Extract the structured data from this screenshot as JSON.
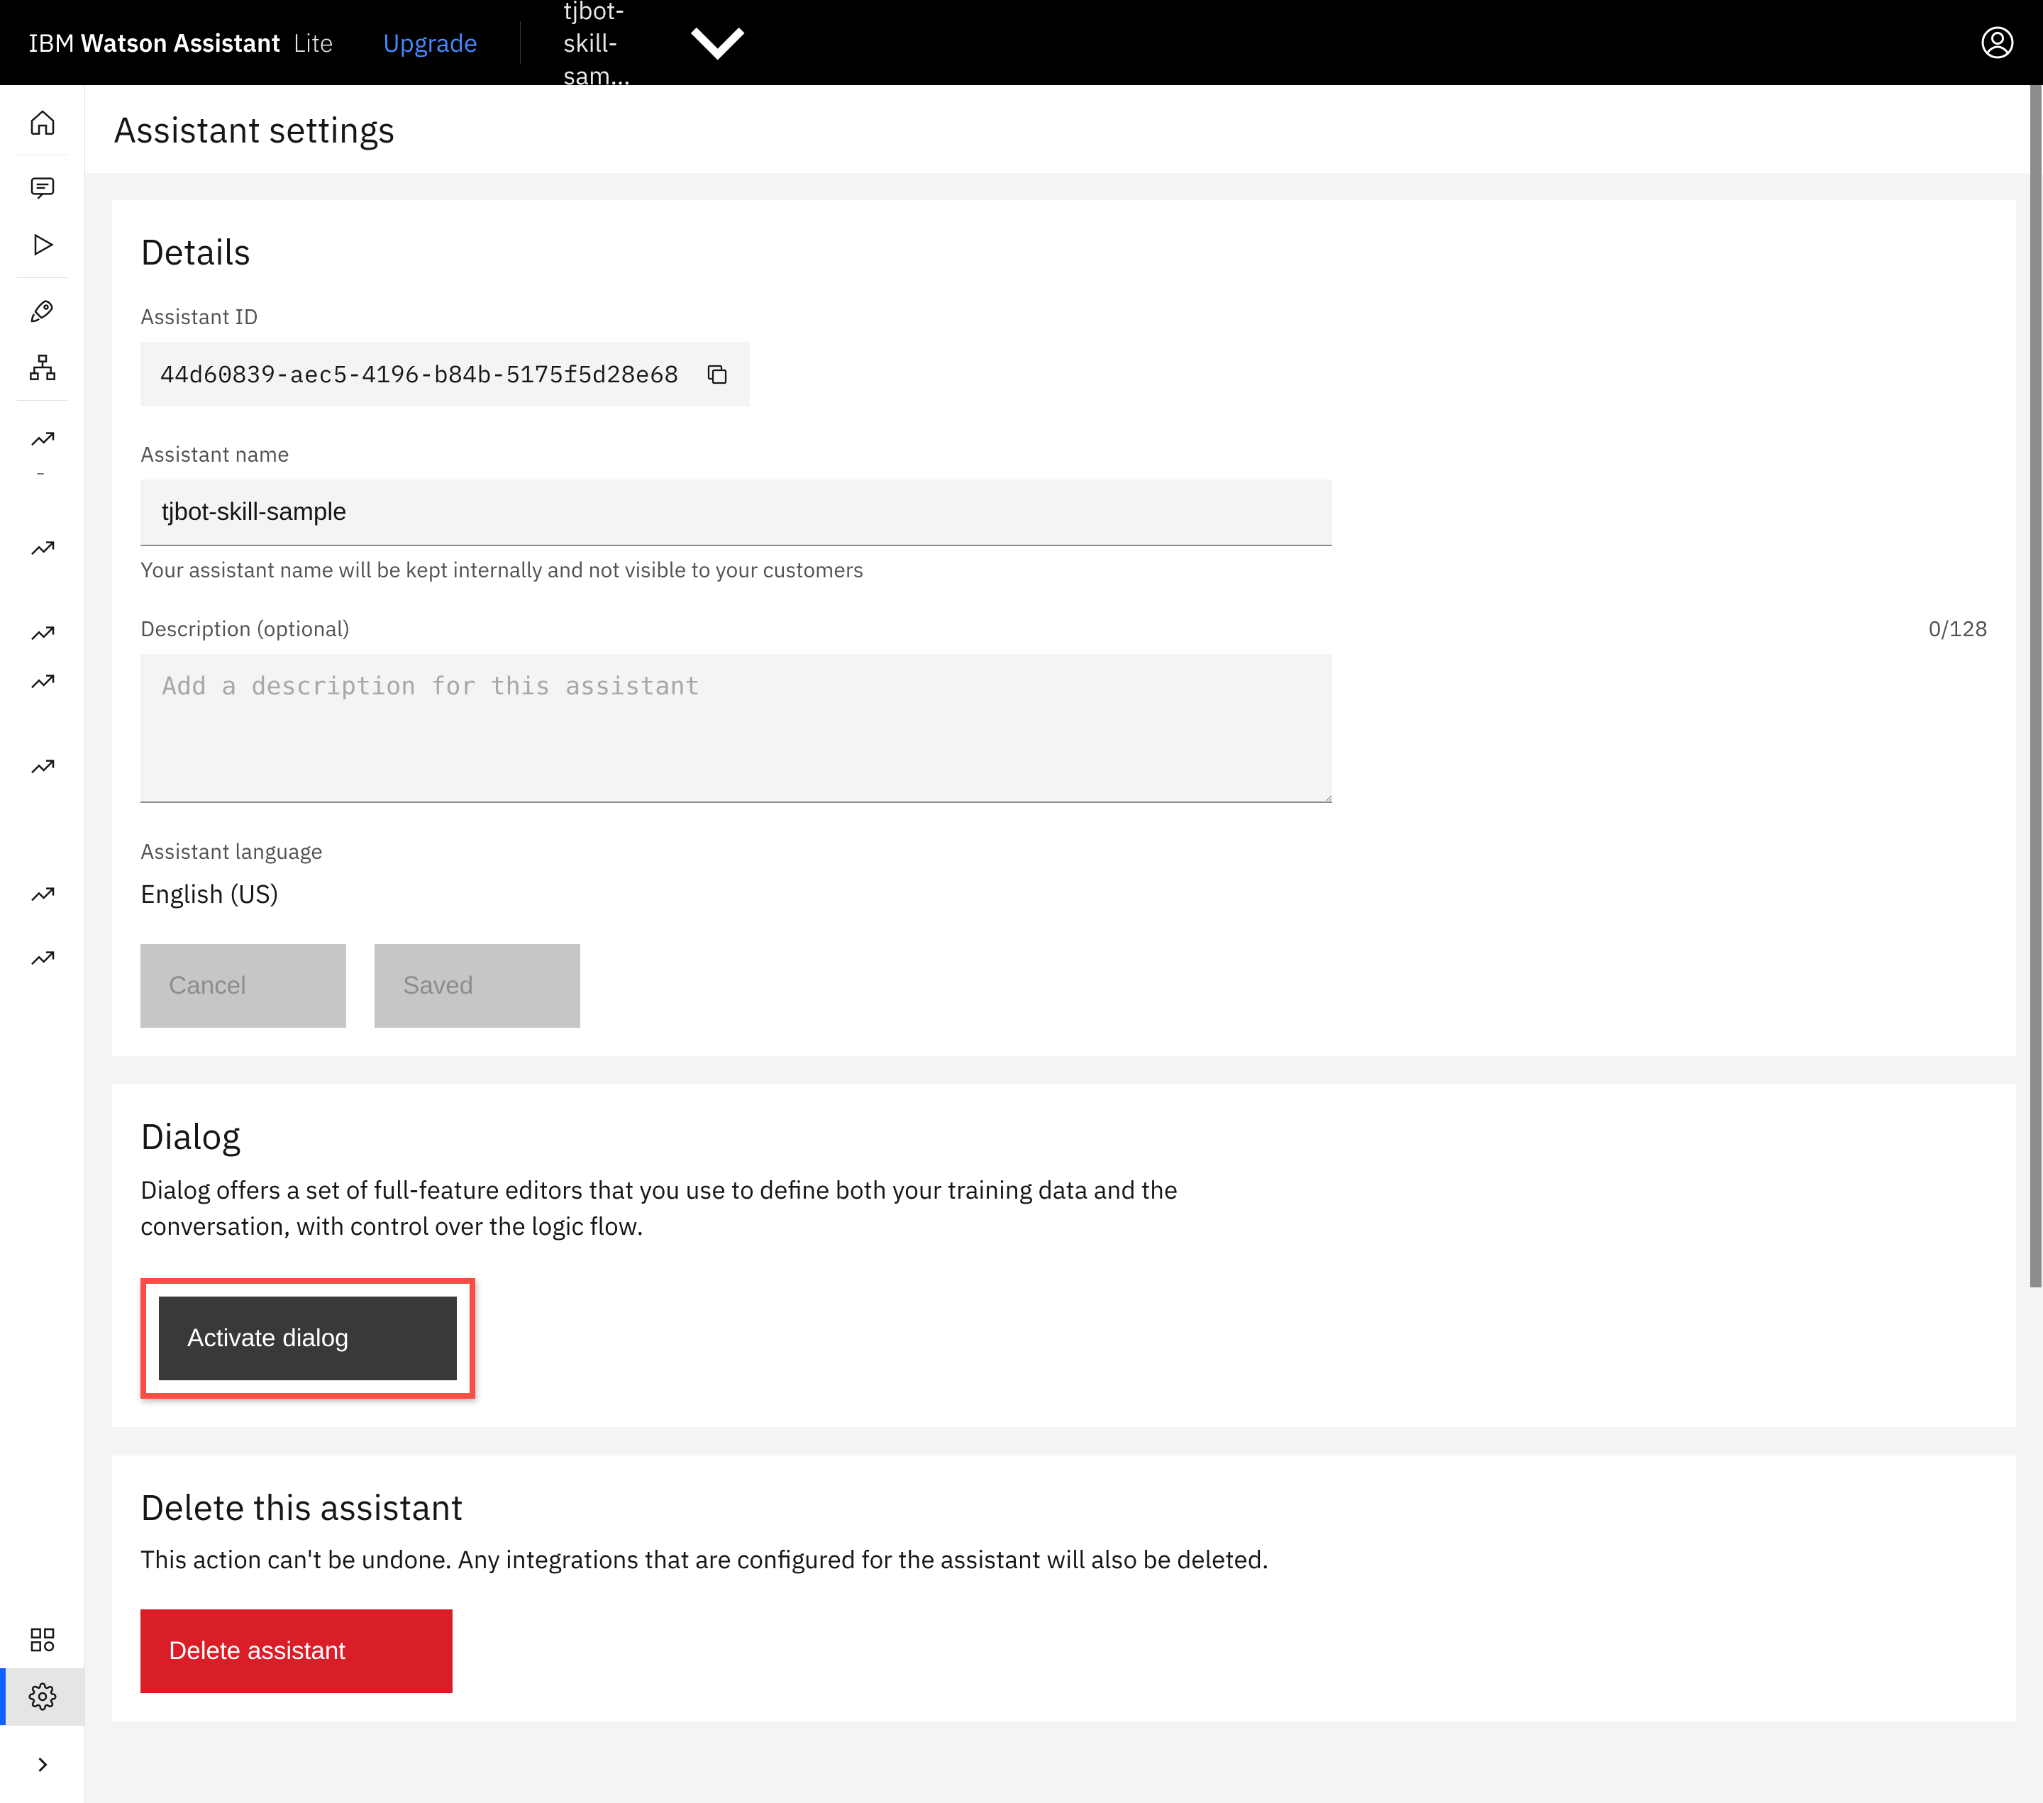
{
  "header": {
    "brand_prefix": "IBM",
    "brand_main": "Watson Assistant",
    "plan": "Lite",
    "upgrade_label": "Upgrade",
    "skill_name": "tjbot-skill-sam…"
  },
  "page": {
    "title": "Assistant settings"
  },
  "details": {
    "heading": "Details",
    "assistant_id_label": "Assistant ID",
    "assistant_id": "44d60839-aec5-4196-b84b-5175f5d28e68",
    "name_label": "Assistant name",
    "name_value": "tjbot-skill-sample",
    "name_helper": "Your assistant name will be kept internally and not visible to your customers",
    "description_label": "Description (optional)",
    "description_count": "0/128",
    "description_placeholder": "Add a description for this assistant",
    "description_value": "",
    "language_label": "Assistant language",
    "language_value": "English (US)",
    "cancel_label": "Cancel",
    "save_label": "Saved"
  },
  "dialog": {
    "heading": "Dialog",
    "description": "Dialog offers a set of full-feature editors that you use to define both your training data and the conversation, with control over the logic flow.",
    "activate_label": "Activate dialog"
  },
  "delete": {
    "heading": "Delete this assistant",
    "description": "This action can't be undone. Any integrations that are configured for the assistant will also be deleted.",
    "button_label": "Delete assistant"
  },
  "sidebar": {
    "items": [
      {
        "name": "home-icon"
      },
      {
        "name": "chat-icon"
      },
      {
        "name": "play-icon"
      },
      {
        "name": "rocket-icon"
      },
      {
        "name": "hierarchy-icon"
      },
      {
        "name": "analytics-icon-1"
      },
      {
        "name": "analytics-icon-2"
      },
      {
        "name": "analytics-icon-3"
      },
      {
        "name": "analytics-icon-4"
      },
      {
        "name": "analytics-icon-5"
      },
      {
        "name": "analytics-icon-6"
      },
      {
        "name": "analytics-icon-7"
      },
      {
        "name": "integrations-icon"
      },
      {
        "name": "settings-icon",
        "active": true
      }
    ]
  }
}
